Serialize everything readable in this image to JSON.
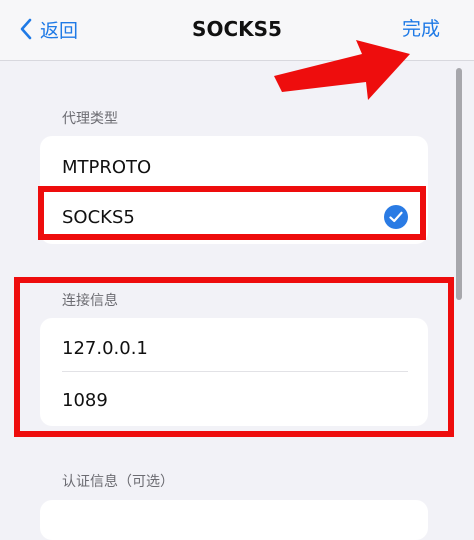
{
  "nav": {
    "back_label": "返回",
    "title": "SOCKS5",
    "done_label": "完成"
  },
  "proxy_type": {
    "label": "代理类型",
    "options": [
      {
        "label": "MTPROTO",
        "selected": false
      },
      {
        "label": "SOCKS5",
        "selected": true
      }
    ]
  },
  "connection": {
    "label": "连接信息",
    "server": "127.0.0.1",
    "port": "1089"
  },
  "auth": {
    "label": "认证信息（可选）"
  },
  "colors": {
    "accent": "#1f7ae6",
    "highlight": "#ee0d0d",
    "background": "#f2f2f7"
  }
}
